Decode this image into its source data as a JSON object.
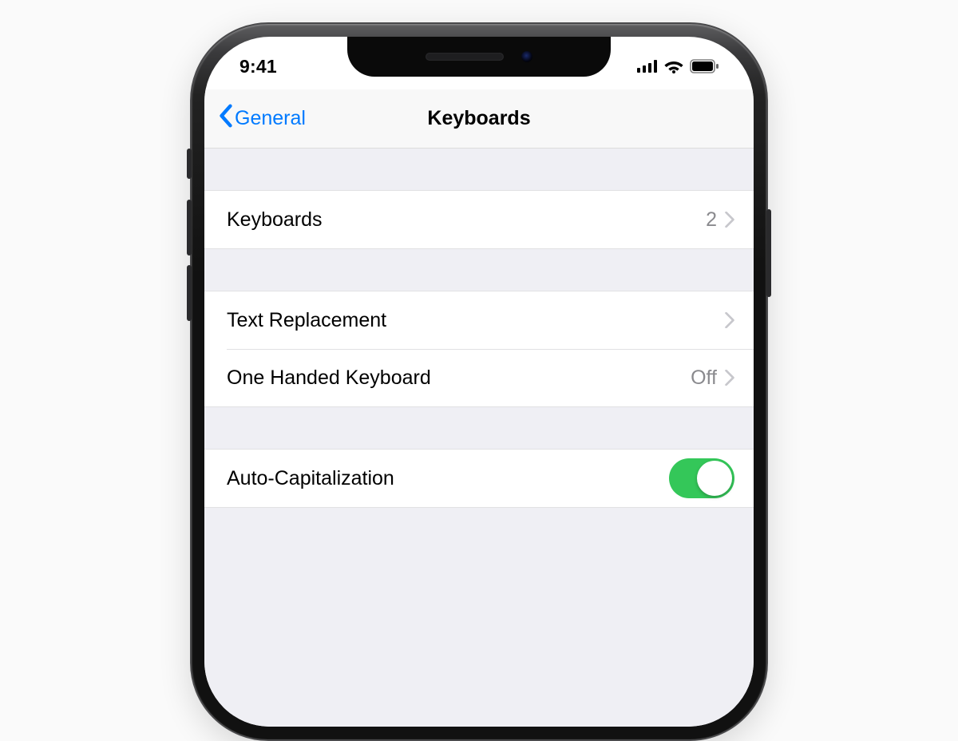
{
  "status": {
    "time": "9:41"
  },
  "nav": {
    "back_label": "General",
    "title": "Keyboards"
  },
  "rows": {
    "keyboards": {
      "label": "Keyboards",
      "value": "2"
    },
    "text_replacement": {
      "label": "Text Replacement"
    },
    "one_handed": {
      "label": "One Handed Keyboard",
      "value": "Off"
    },
    "auto_cap": {
      "label": "Auto-Capitalization",
      "on": true
    }
  },
  "colors": {
    "link": "#007aff",
    "toggle_on": "#34c759"
  }
}
